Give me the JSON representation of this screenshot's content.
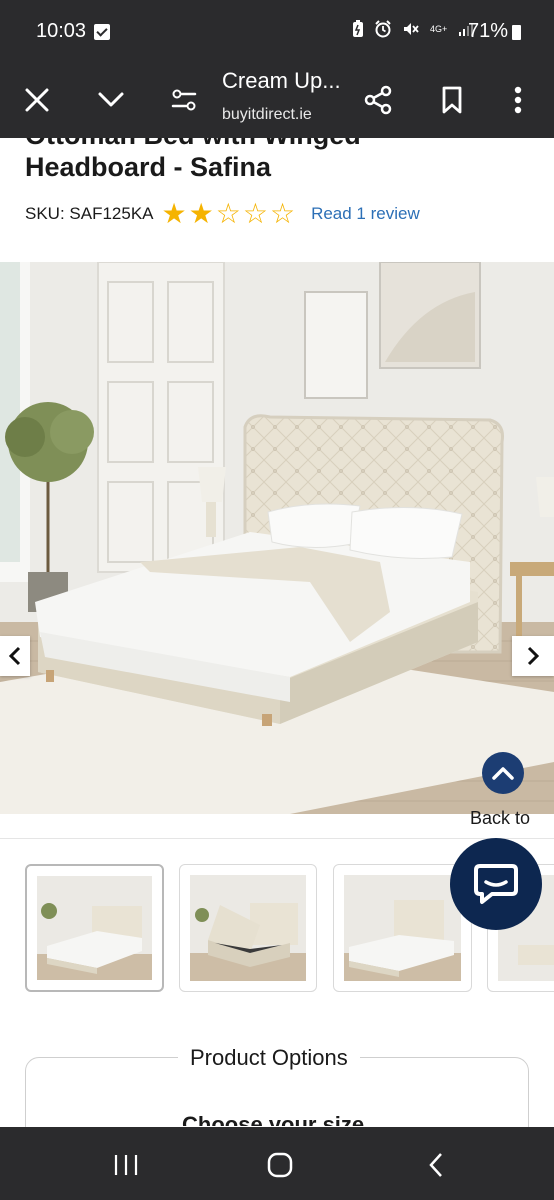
{
  "status_bar": {
    "time": "10:03",
    "battery": "71%",
    "network": "4G+"
  },
  "toolbar": {
    "title": "Cream Up...",
    "url": "buyitdirect.ie"
  },
  "product": {
    "title_line_1": "Ottoman Bed with Winged",
    "title_line_2": "Headboard - Safina",
    "sku": "SKU: SAF125KA",
    "rating": 2,
    "rating_max": 5,
    "review_link": "Read 1 review"
  },
  "gallery": {
    "prev": "‹",
    "next": "›",
    "thumbnails": [
      {
        "name": "bed-front-view"
      },
      {
        "name": "bed-storage-open"
      },
      {
        "name": "bed-side-view"
      },
      {
        "name": "bed-detail"
      }
    ]
  },
  "back_to_top": {
    "label": "Back to"
  },
  "options": {
    "legend": "Product Options",
    "choose_size": "Choose your size"
  },
  "colors": {
    "dark_bar": "#2b2b2d",
    "star": "#f5b301",
    "link": "#2c6fb6",
    "navy": "#0d2750"
  }
}
